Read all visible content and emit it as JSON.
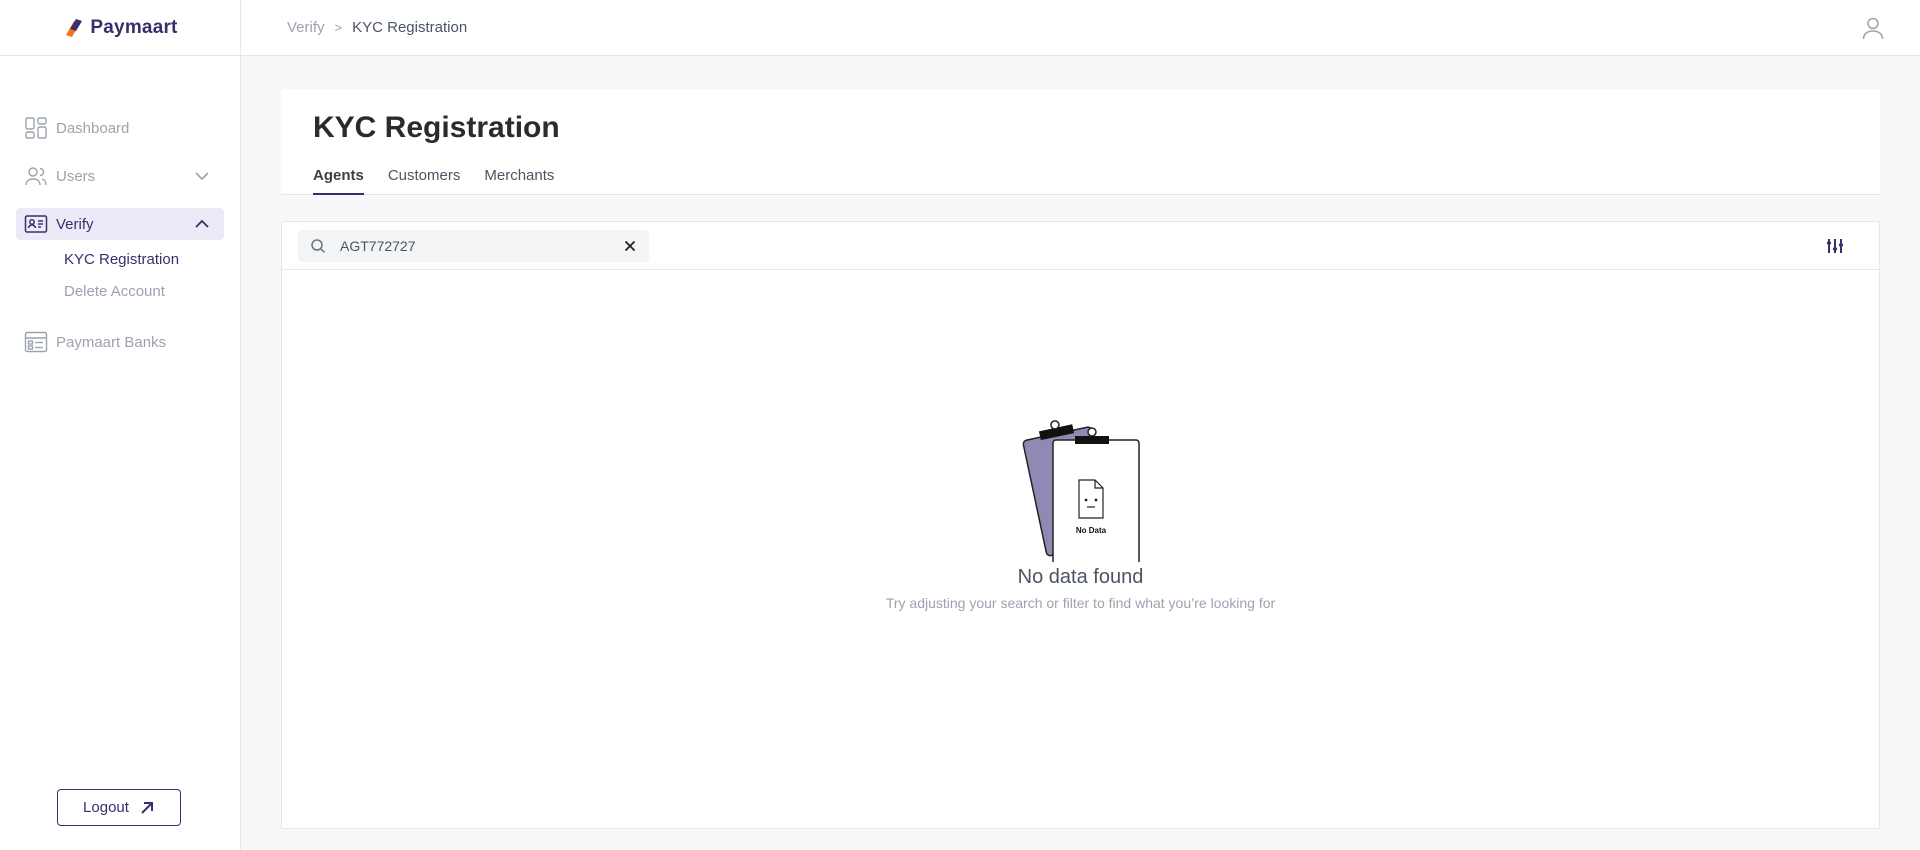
{
  "app": {
    "name": "Paymaart"
  },
  "breadcrumb": {
    "root": "Verify",
    "separator": ">",
    "current": "KYC Registration"
  },
  "sidebar": {
    "items": [
      {
        "label": "Dashboard",
        "icon": "dashboard-icon"
      },
      {
        "label": "Users",
        "icon": "users-icon",
        "expandable": true,
        "expanded": false
      },
      {
        "label": "Verify",
        "icon": "id-card-icon",
        "expandable": true,
        "expanded": true,
        "subitems": [
          {
            "label": "KYC Registration",
            "current": true
          },
          {
            "label": "Delete Account"
          }
        ]
      },
      {
        "label": "Paymaart Banks",
        "icon": "bank-list-icon"
      }
    ],
    "logout_label": "Logout"
  },
  "page": {
    "title": "KYC Registration",
    "tabs": [
      {
        "label": "Agents",
        "active": true
      },
      {
        "label": "Customers"
      },
      {
        "label": "Merchants"
      }
    ]
  },
  "search": {
    "value": "AGT772727",
    "placeholder": ""
  },
  "empty_state": {
    "illustration_label": "No Data",
    "title": "No data found",
    "subtitle": "Try adjusting your search or filter to find what you’re looking for"
  },
  "colors": {
    "brand": "#3b2f6b",
    "active_bg": "#ede9f7",
    "muted": "#9ca3af",
    "clipboard": "#9189b3"
  }
}
